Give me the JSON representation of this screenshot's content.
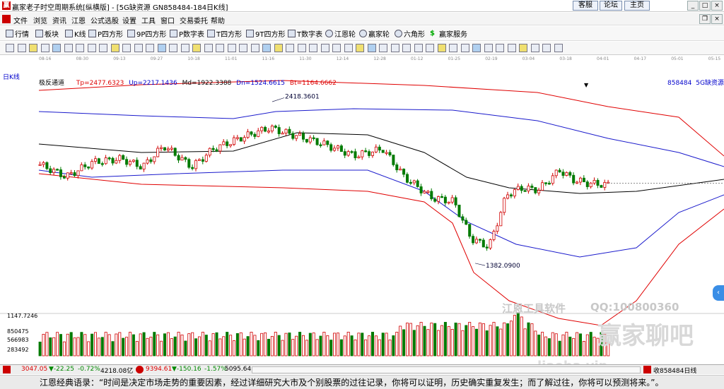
{
  "window": {
    "title": "赢家老子时空周期系统[纵横版] - [5G缺资源  GN858484-184日K线]",
    "links": [
      "客服",
      "论坛",
      "主页"
    ]
  },
  "menu": [
    "文件",
    "浏览",
    "资讯",
    "江恩",
    "公式选股",
    "设置",
    "工具",
    "窗口",
    "交易委托",
    "帮助"
  ],
  "toolbar1": [
    "行情",
    "板块",
    "K线",
    "P四方形",
    "9P四方形",
    "P数字表",
    "T四方形",
    "9T四方形",
    "T数字表",
    "江恩轮",
    "赢家轮",
    "六角形",
    "赢家服务"
  ],
  "dates": [
    "08-16",
    "08-30",
    "09-13",
    "09-27",
    "10-18",
    "11-01",
    "11-16",
    "11-30",
    "12-14",
    "12-28",
    "01-12",
    "01-25",
    "02-19",
    "03-04",
    "03-18",
    "04-01",
    "04-17",
    "05-01",
    "05-15"
  ],
  "chart_header": {
    "period": "日K线",
    "indicator": "极反通道",
    "tp": "Tp=2477.6323",
    "up": "Up=2217.1436",
    "md": "Md=1922.3388",
    "dn": "Dn=1524.6615",
    "bt": "Bt=1164.6662",
    "code": "858484",
    "name": "5G缺资源"
  },
  "annotations": {
    "high": "2418.3601",
    "low": "1382.0900"
  },
  "volume_axis": [
    "1147.7246",
    "850475",
    "566983",
    "283492"
  ],
  "watermarks": {
    "brand": "江恩工具软件",
    "qq": "QQ:100800360",
    "forum": "赢家聊吧",
    "site": "liaoba.vip"
  },
  "statusbar": {
    "sh": "3047.05",
    "sh_chg": "▼-22.25",
    "sh_pct": "-0.72%",
    "sh_vol": "4218.08亿",
    "sz": "9394.61",
    "sz_chg": "▼-150.16",
    "sz_pct": "-1.57%",
    "sz_vol": "5095.64",
    "right": "收858484日线"
  },
  "quote": "江恩经典语录：“时间是决定市场走势的重要因素，经过详细研究大市及个别股票的过往记录，你将可以证明，历史确实重复发生；而了解过往，你将可以预测将来。”。",
  "colors": {
    "up": "#d00000",
    "down": "#007a00",
    "band_outer": "#e00000",
    "band_mid": "#1a1acc",
    "band_center": "#000000"
  },
  "chart_data": {
    "type": "candlestick",
    "title": "",
    "ylim": [
      1300,
      2520
    ],
    "bands": {
      "tp": 2477.6323,
      "up": 2217.1436,
      "md": 1922.3388,
      "dn": 1524.6615,
      "bt": 1164.6662
    },
    "high_label": 2418.3601,
    "low_label": 1382.09,
    "volume_max": 1147.7246
  }
}
